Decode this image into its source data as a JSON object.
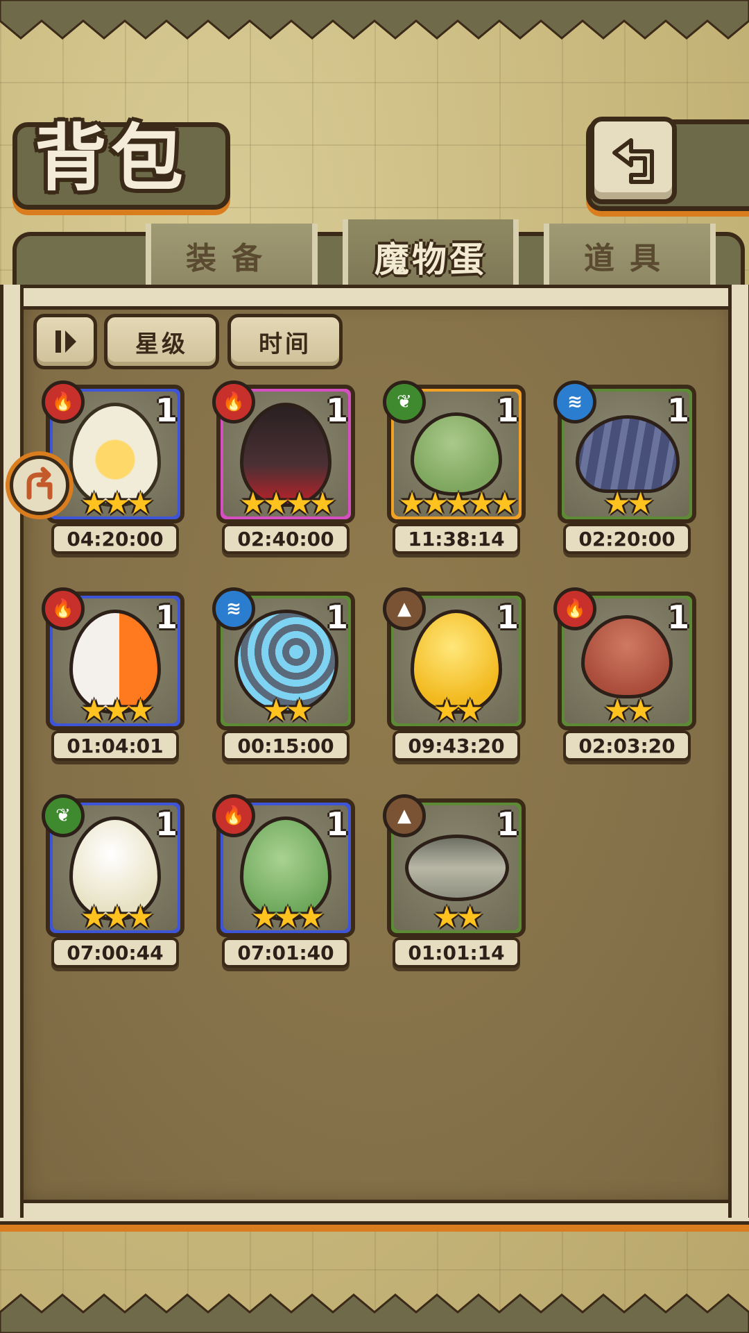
{
  "header": {
    "title": "背包",
    "back_icon": "return-arrow-icon"
  },
  "tabs": [
    {
      "label": "装备",
      "active": false
    },
    {
      "label": "魔物蛋",
      "active": true
    },
    {
      "label": "道具",
      "active": false
    }
  ],
  "sort": {
    "toggle_icon": "sort-toggle-icon",
    "by_star": "星级",
    "by_time": "时间"
  },
  "colors": {
    "fire": "#c8312b",
    "grass": "#3f8a2f",
    "water": "#2b7ecf",
    "earth": "#7a5234",
    "blue_frame": "#3d55d6",
    "pink_frame": "#d54fc0",
    "orange_frame": "#f0a126",
    "green_frame": "#5c8a35"
  },
  "eggs": [
    {
      "element": "fire",
      "count": "1",
      "stars": "★★★",
      "timer": "04:20:00"
    },
    {
      "element": "fire",
      "count": "1",
      "stars": "★★★★",
      "timer": "02:40:00"
    },
    {
      "element": "grass",
      "count": "1",
      "stars": "★★★★★",
      "timer": "11:38:14"
    },
    {
      "element": "water",
      "count": "1",
      "stars": "★★",
      "timer": "02:20:00"
    },
    {
      "element": "fire",
      "count": "1",
      "stars": "★★★",
      "timer": "01:04:01"
    },
    {
      "element": "water",
      "count": "1",
      "stars": "★★",
      "timer": "00:15:00"
    },
    {
      "element": "earth",
      "count": "1",
      "stars": "★★",
      "timer": "09:43:20"
    },
    {
      "element": "fire",
      "count": "1",
      "stars": "★★",
      "timer": "02:03:20"
    },
    {
      "element": "grass",
      "count": "1",
      "stars": "★★★",
      "timer": "07:00:44"
    },
    {
      "element": "fire",
      "count": "1",
      "stars": "★★★",
      "timer": "07:01:40"
    },
    {
      "element": "earth",
      "count": "1",
      "stars": "★★",
      "timer": "01:01:14"
    }
  ]
}
